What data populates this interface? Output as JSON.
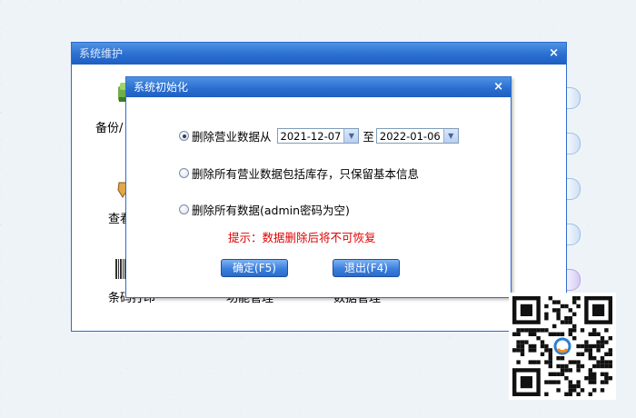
{
  "outer_window": {
    "title": "系统维护",
    "close_label": "×",
    "items": [
      {
        "label": "备份/",
        "icon": "backup-icon"
      },
      {
        "label": "查看",
        "icon": "view-icon"
      },
      {
        "label": "条码打印",
        "icon": "barcode-icon"
      },
      {
        "label": "功能管理",
        "icon": "none"
      },
      {
        "label": "数据管理",
        "icon": "none"
      }
    ]
  },
  "dialog": {
    "title": "系统初始化",
    "close_label": "×",
    "option1": {
      "label": "删除营业数据从",
      "selected": true,
      "from_date": "2021-12-07",
      "to_label": "至",
      "to_date": "2022-01-06"
    },
    "option2": {
      "label": "删除所有营业数据包括库存，只保留基本信息",
      "selected": false
    },
    "option3": {
      "label": "删除所有数据(admin密码为空)",
      "selected": false
    },
    "warning": "提示：数据删除后将不可恢复",
    "confirm_button": "确定(F5)",
    "exit_button": "退出(F4)"
  },
  "colors": {
    "titlebar": "#2a6fd0",
    "warning": "#e00000",
    "button": "#3a7fde"
  },
  "qr_code": {
    "icon": "qr-code-icon"
  }
}
